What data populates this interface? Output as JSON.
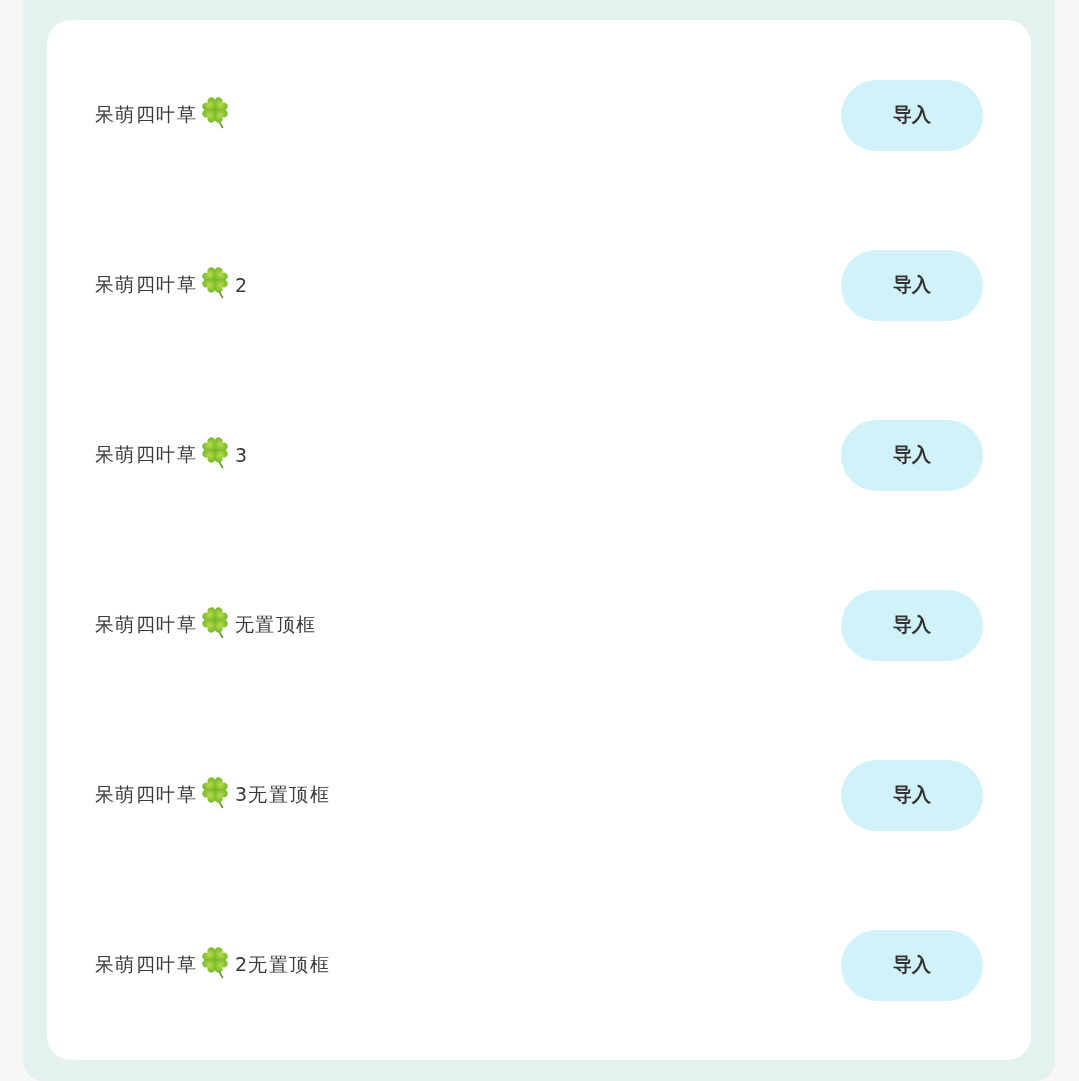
{
  "list": {
    "items": [
      {
        "name": "呆萌四叶草",
        "button": "导入"
      },
      {
        "name": "呆萌四叶草",
        "suffix": "2",
        "button": "导入"
      },
      {
        "name": "呆萌四叶草",
        "suffix": "3",
        "button": "导入"
      },
      {
        "name": "呆萌四叶草",
        "suffix": "无置顶框",
        "button": "导入"
      },
      {
        "name": "呆萌四叶草",
        "suffix": "3无置顶框",
        "button": "导入"
      },
      {
        "name": "呆萌四叶草",
        "suffix": "2无置顶框",
        "button": "导入"
      }
    ]
  }
}
